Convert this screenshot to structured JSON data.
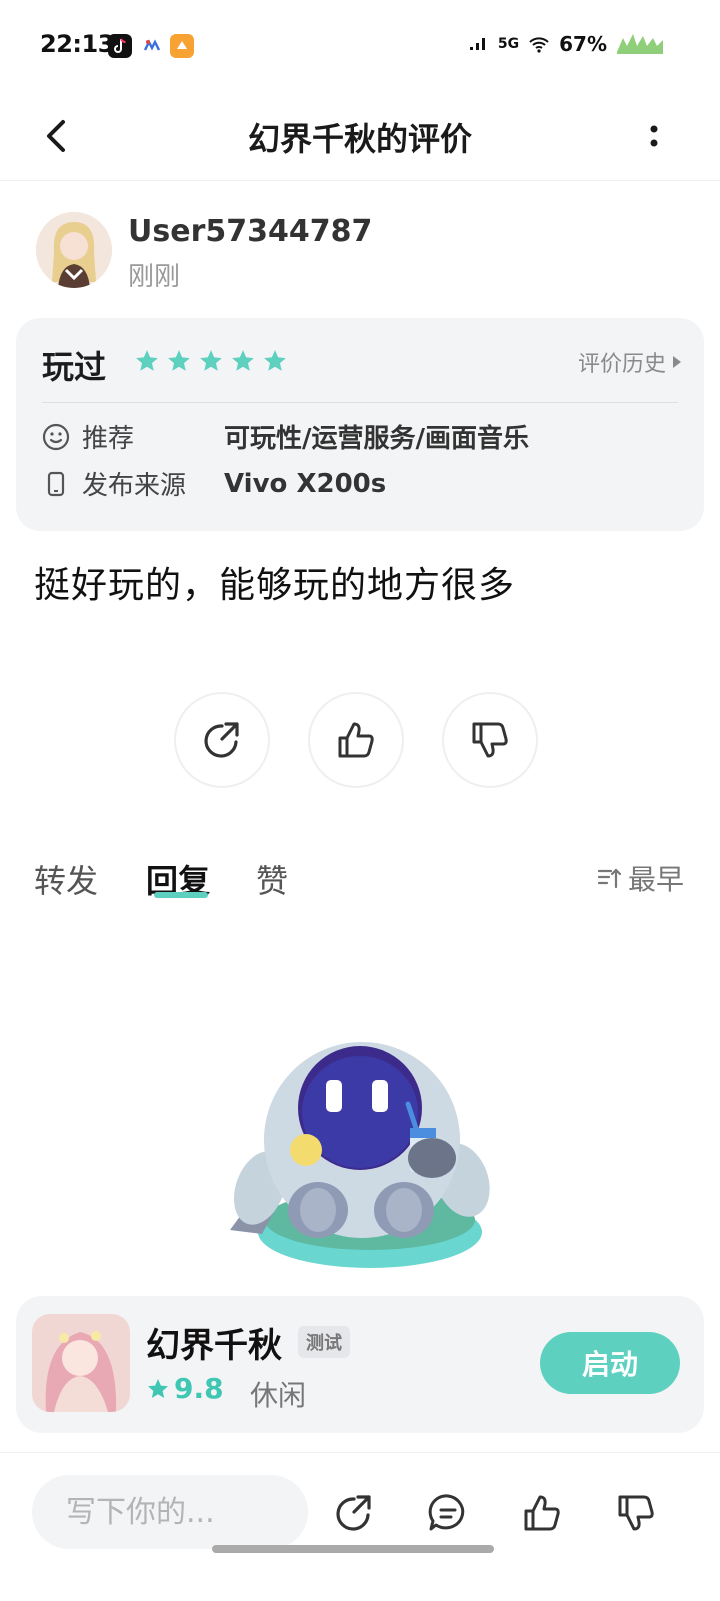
{
  "status_bar": {
    "time": "22:13",
    "battery": "67%",
    "network": "5G",
    "icons": [
      "tiktok-icon",
      "notification-icon",
      "app-icon",
      "signal-icon",
      "wifi-icon",
      "battery-icon"
    ]
  },
  "header": {
    "title": "幻界千秋的评价",
    "icons": [
      "back-arrow-icon",
      "more-vertical-icon"
    ]
  },
  "author": {
    "name": "User57344787",
    "time": "刚刚"
  },
  "review_card": {
    "status": "玩过",
    "stars": 5,
    "history_label": "评价历史",
    "recommend_label": "推荐",
    "recommend_value": "可玩性/运营服务/画面音乐",
    "source_label": "发布来源",
    "source_value": "Vivo X200s",
    "accent_color": "#5ed0c0"
  },
  "review": {
    "text": "挺好玩的，能够玩的地方很多"
  },
  "actions": [
    "share-icon",
    "thumbs-up-icon",
    "thumbs-down-icon"
  ],
  "tabs": {
    "items": [
      "转发",
      "回复",
      "赞"
    ],
    "active": "回复",
    "sort_label": "最早"
  },
  "game": {
    "name": "幻界千秋",
    "tag": "测试",
    "rating": "9.8",
    "genre": "休闲",
    "launch_label": "启动"
  },
  "bottom_bar": {
    "input_placeholder": "写下你的..."
  }
}
